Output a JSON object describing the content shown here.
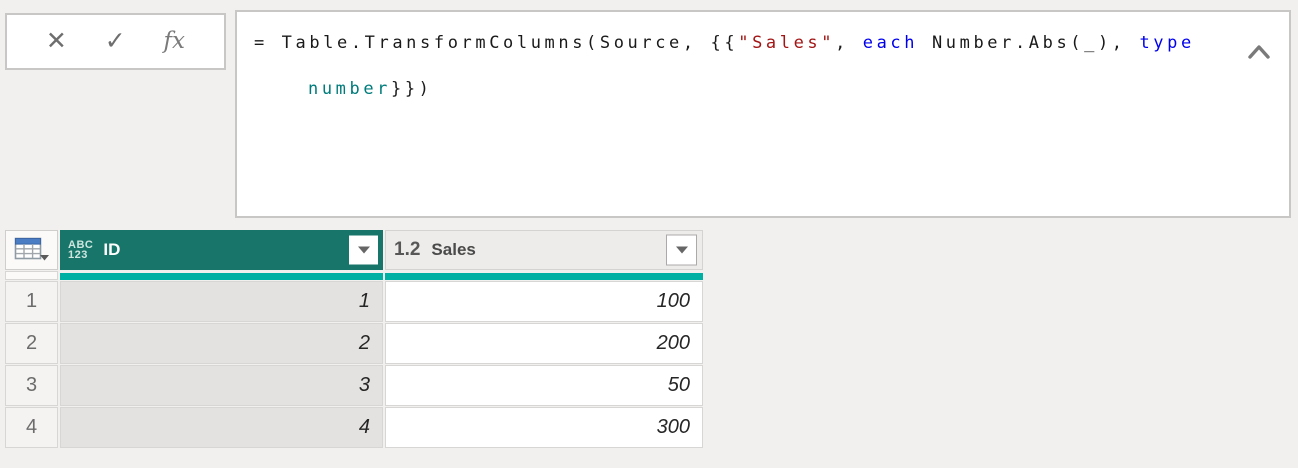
{
  "formula_bar": {
    "cancel_label": "✕",
    "commit_label": "✓",
    "fx_label": "fx",
    "lines": [
      [
        {
          "t": "= Table.TransformColumns(Source, {{",
          "c": "plain"
        },
        {
          "t": "\"Sales\"",
          "c": "string"
        },
        {
          "t": ", ",
          "c": "plain"
        },
        {
          "t": "each",
          "c": "keyword"
        },
        {
          "t": " Number.Abs(_), ",
          "c": "plain"
        },
        {
          "t": "type",
          "c": "keyword"
        }
      ],
      [
        {
          "t": "number",
          "c": "type"
        },
        {
          "t": "}})",
          "c": "plain"
        }
      ]
    ]
  },
  "colors": {
    "header_selected_teal": "#177669",
    "quality_bar_teal": "#00B0A2",
    "keyword_blue": "#0000EE",
    "string_red": "#A31515",
    "type_teal": "#007B7B",
    "page_background": "#F1F0EE"
  },
  "table": {
    "columns": [
      {
        "name": "ID",
        "type_icon_line1": "ABC",
        "type_icon_line2": "123"
      },
      {
        "name": "Sales",
        "type_icon": "1.2"
      }
    ],
    "rows": [
      {
        "num": "1",
        "id": "1",
        "sales": "100"
      },
      {
        "num": "2",
        "id": "2",
        "sales": "200"
      },
      {
        "num": "3",
        "id": "3",
        "sales": "50"
      },
      {
        "num": "4",
        "id": "4",
        "sales": "300"
      }
    ]
  }
}
